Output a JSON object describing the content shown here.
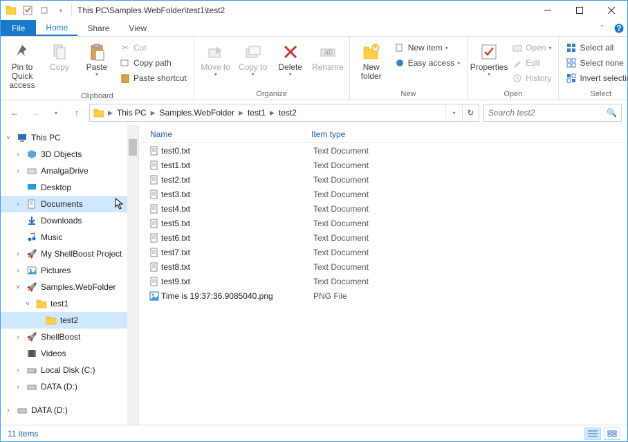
{
  "window": {
    "title": "This PC\\Samples.WebFolder\\test1\\test2"
  },
  "tabs": {
    "file": "File",
    "home": "Home",
    "share": "Share",
    "view": "View"
  },
  "ribbon": {
    "clipboard": {
      "label": "Clipboard",
      "pin": "Pin to Quick access",
      "copy": "Copy",
      "paste": "Paste",
      "cut": "Cut",
      "copy_path": "Copy path",
      "paste_shortcut": "Paste shortcut"
    },
    "organize": {
      "label": "Organize",
      "move_to": "Move to",
      "copy_to": "Copy to",
      "delete": "Delete",
      "rename": "Rename"
    },
    "new": {
      "label": "New",
      "new_folder": "New folder",
      "new_item": "New item",
      "easy_access": "Easy access"
    },
    "open": {
      "label": "Open",
      "properties": "Properties",
      "open": "Open",
      "edit": "Edit",
      "history": "History"
    },
    "select": {
      "label": "Select",
      "select_all": "Select all",
      "select_none": "Select none",
      "invert": "Invert selection"
    }
  },
  "breadcrumb": [
    "This PC",
    "Samples.WebFolder",
    "test1",
    "test2"
  ],
  "search_placeholder": "Search test2",
  "tree": {
    "this_pc": "This PC",
    "three_d": "3D Objects",
    "amalga": "AmalgaDrive",
    "desktop": "Desktop",
    "documents": "Documents",
    "downloads": "Downloads",
    "music": "Music",
    "shellboost_proj": "My ShellBoost Project",
    "pictures": "Pictures",
    "samples_web": "Samples.WebFolder",
    "test1": "test1",
    "test2": "test2",
    "shellboost": "ShellBoost",
    "videos": "Videos",
    "local_c": "Local Disk (C:)",
    "data_d1": "DATA (D:)",
    "data_d2": "DATA (D:)"
  },
  "columns": {
    "name": "Name",
    "item_type": "Item type"
  },
  "files": [
    {
      "name": "test0.txt",
      "type": "Text Document",
      "icon": "text"
    },
    {
      "name": "test1.txt",
      "type": "Text Document",
      "icon": "text"
    },
    {
      "name": "test2.txt",
      "type": "Text Document",
      "icon": "text"
    },
    {
      "name": "test3.txt",
      "type": "Text Document",
      "icon": "text"
    },
    {
      "name": "test4.txt",
      "type": "Text Document",
      "icon": "text"
    },
    {
      "name": "test5.txt",
      "type": "Text Document",
      "icon": "text"
    },
    {
      "name": "test6.txt",
      "type": "Text Document",
      "icon": "text"
    },
    {
      "name": "test7.txt",
      "type": "Text Document",
      "icon": "text"
    },
    {
      "name": "test8.txt",
      "type": "Text Document",
      "icon": "text"
    },
    {
      "name": "test9.txt",
      "type": "Text Document",
      "icon": "text"
    },
    {
      "name": "Time is 19:37:36.9085040.png",
      "type": "PNG File",
      "icon": "png"
    }
  ],
  "status": {
    "count": "11 items"
  }
}
